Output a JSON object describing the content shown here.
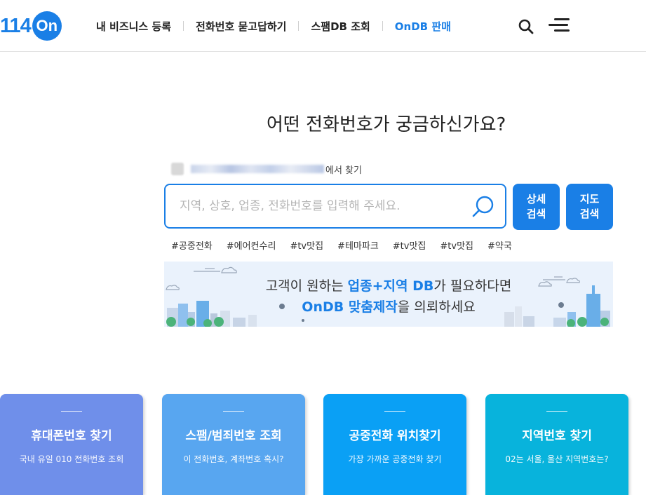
{
  "logo": {
    "num": "114",
    "on": "On"
  },
  "nav": {
    "items": [
      {
        "label": "내 비즈니스 등록"
      },
      {
        "label": "전화번호 묻고답하기"
      },
      {
        "label": "스팸DB 조회"
      },
      {
        "label": "OnDB 판매"
      }
    ]
  },
  "hero": {
    "headline": "어떤 전화번호가 궁금하신가요?",
    "location_suffix": "에서 찾기",
    "search_placeholder": "지역, 상호, 업종, 전화번호를 입력해 주세요.",
    "detail_btn": [
      "상세",
      "검색"
    ],
    "map_btn": [
      "지도",
      "검색"
    ],
    "tags": [
      "#공중전화",
      "#에어컨수리",
      "#tv맛집",
      "#테마파크",
      "#tv맛집",
      "#tv맛집",
      "#약국"
    ]
  },
  "banner": {
    "line1_pre": "고객이 원하는 ",
    "line1_hl": "업종+지역 DB",
    "line1_post": "가 필요하다면",
    "line2_hl": "OnDB 맞춤제작",
    "line2_post": "을 의뢰하세요"
  },
  "cards": [
    {
      "title": "휴대폰번호 찾기",
      "subtitle": "국내 유일 010 전화번호 조회"
    },
    {
      "title": "스팸/범죄번호 조회",
      "subtitle": "이 전화번호, 계좌번호 혹시?"
    },
    {
      "title": "공중전화 위치찾기",
      "subtitle": "가장 가까운 공중전화 찾기"
    },
    {
      "title": "지역번호 찾기",
      "subtitle": "02는 서울, 울산 지역번호는?"
    }
  ],
  "colors": {
    "brand": "#1a7fe6",
    "card1": "#6f8fea",
    "card2": "#58a6f0",
    "card3": "#0aa0f5",
    "card4": "#08b3dc"
  }
}
